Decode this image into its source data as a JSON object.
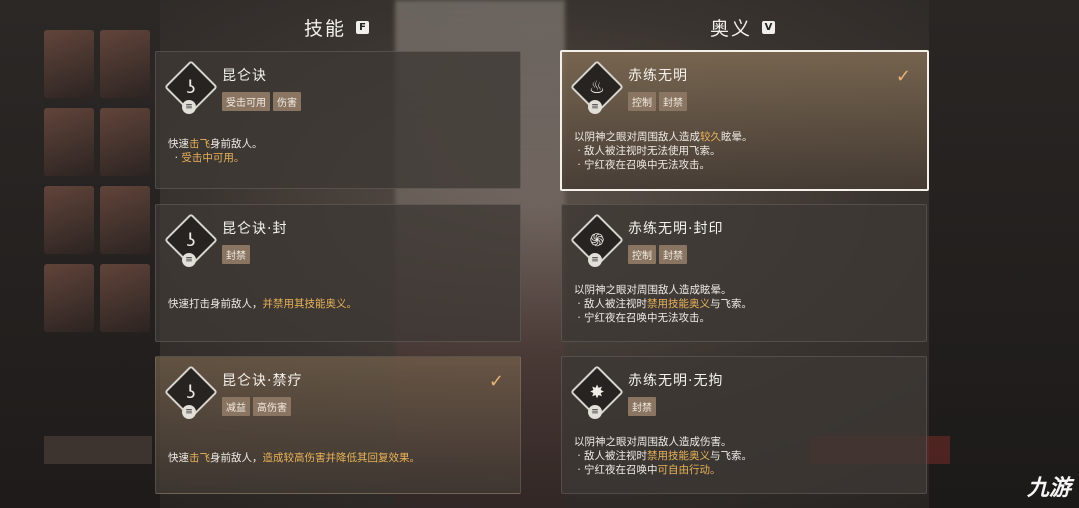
{
  "skills_header": {
    "title": "技能",
    "key": "F"
  },
  "ultimate_header": {
    "title": "奥义",
    "key": "V"
  },
  "skills": [
    {
      "title": "昆仑诀",
      "tags": [
        "受击可用",
        "伤害"
      ],
      "icon": "skill-slash-icon",
      "checked": false,
      "desc": [
        [
          "快速",
          "击飞",
          "身前敌人。"
        ],
        [
          "  · ",
          "受击中可用。",
          ""
        ]
      ]
    },
    {
      "title": "昆仑诀·封",
      "tags": [
        "封禁"
      ],
      "icon": "skill-slash-icon",
      "checked": false,
      "desc": [
        [
          "快速打击身前敌人，",
          "并禁用其技能奥义。",
          ""
        ]
      ]
    },
    {
      "title": "昆仑诀·禁疗",
      "tags": [
        "减益",
        "高伤害"
      ],
      "icon": "skill-slash-icon",
      "checked": true,
      "desc": [
        [
          "快速",
          "击飞",
          "身前敌人，"
        ],
        [
          "",
          "造成较高伤害并降低其回复效果。",
          ""
        ]
      ]
    }
  ],
  "ultimates": [
    {
      "title": "赤练无明",
      "tags": [
        "控制",
        "封禁"
      ],
      "icon": "flame-icon",
      "checked": true,
      "lines": [
        "以阴神之眼对周围敌人造成",
        "较久",
        "眩晕。",
        "· 敌人被注视时无法使用飞索。",
        "· 宁红夜在召唤中无法攻击。"
      ]
    },
    {
      "title": "赤练无明·封印",
      "tags": [
        "控制",
        "封禁"
      ],
      "icon": "swirl-icon",
      "checked": false,
      "lines": [
        "以阴神之眼对周围敌人造成眩晕。",
        "· 敌人被注视时",
        "禁用技能奥义",
        "与飞索。",
        "· 宁红夜在召唤中无法攻击。"
      ]
    },
    {
      "title": "赤练无明·无拘",
      "tags": [
        "封禁"
      ],
      "icon": "burst-icon",
      "checked": false,
      "lines": [
        "以阴神之眼对周围敌人造成伤害。",
        "· 敌人被注视时",
        "禁用技能奥义",
        "与飞索。",
        "· 宁红夜在召唤中",
        "可自由行动。"
      ]
    }
  ],
  "check_mark": "✓",
  "watermark": "九游"
}
